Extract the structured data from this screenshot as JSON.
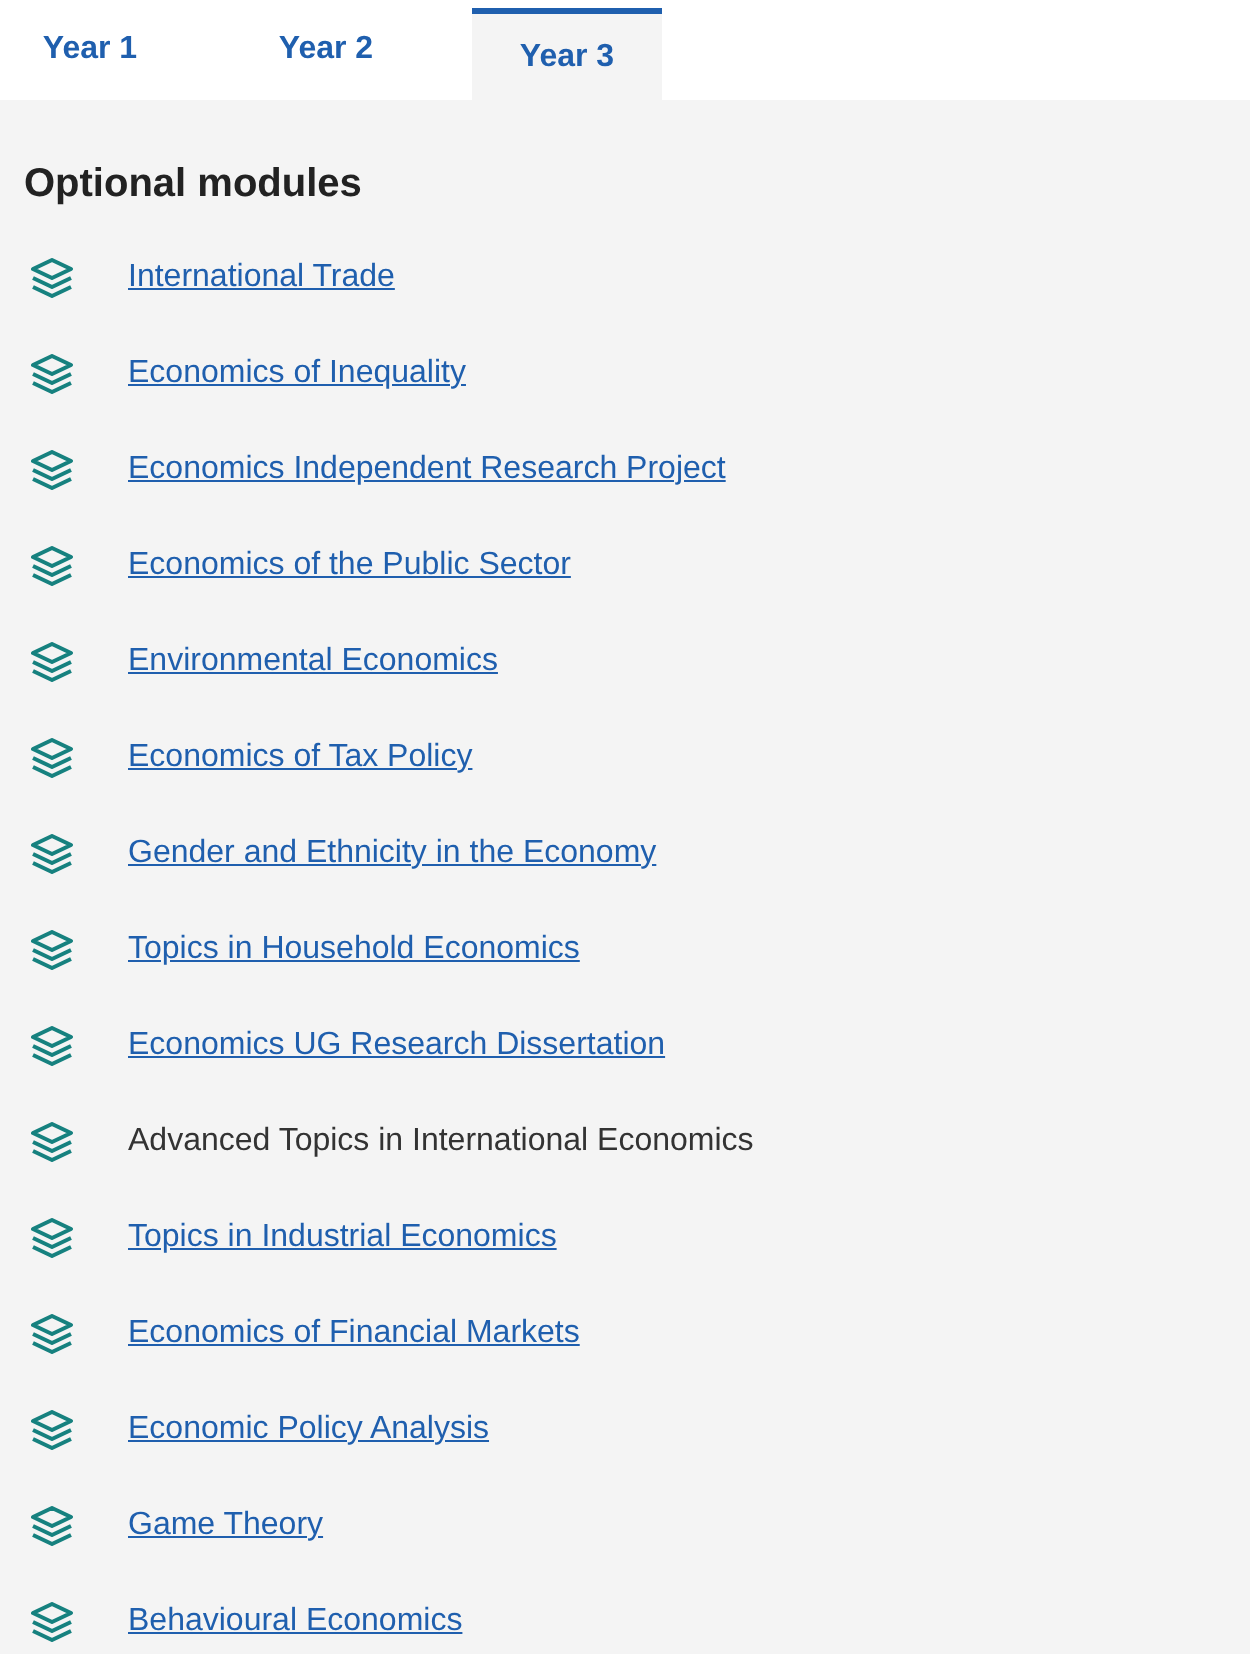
{
  "tabs": [
    {
      "label": "Year 1",
      "selected": false
    },
    {
      "label": "Year 2",
      "selected": false
    },
    {
      "label": "Year 3",
      "selected": true
    }
  ],
  "section": {
    "heading": "Optional modules",
    "modules": [
      {
        "title": "International Trade",
        "kind": "link"
      },
      {
        "title": "Economics of Inequality",
        "kind": "link"
      },
      {
        "title": "Economics Independent Research Project",
        "kind": "link"
      },
      {
        "title": "Economics of the Public Sector",
        "kind": "link"
      },
      {
        "title": "Environmental Economics",
        "kind": "link"
      },
      {
        "title": "Economics of Tax Policy",
        "kind": "link"
      },
      {
        "title": "Gender and Ethnicity in the Economy",
        "kind": "link"
      },
      {
        "title": "Topics in Household Economics",
        "kind": "link"
      },
      {
        "title": "Economics UG Research Dissertation",
        "kind": "link"
      },
      {
        "title": "Advanced Topics in International Economics",
        "kind": "text"
      },
      {
        "title": "Topics in Industrial Economics",
        "kind": "link"
      },
      {
        "title": "Economics of Financial Markets",
        "kind": "link"
      },
      {
        "title": "Economic Policy Analysis",
        "kind": "link"
      },
      {
        "title": "Game Theory",
        "kind": "link"
      },
      {
        "title": "Behavioural Economics",
        "kind": "link"
      }
    ]
  }
}
